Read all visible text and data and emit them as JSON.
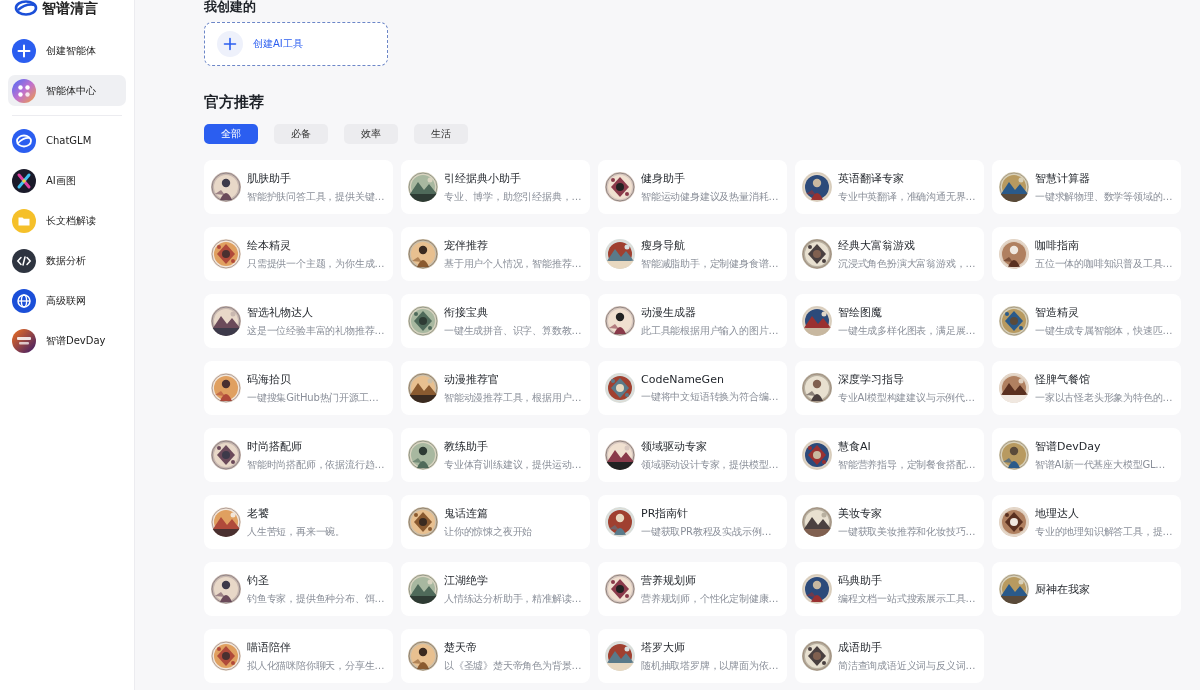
{
  "sidebar": {
    "brand": "智谱清言",
    "actions": [
      {
        "label": "创建智能体",
        "selected": false
      },
      {
        "label": "智能体中心",
        "selected": true
      }
    ],
    "tools": [
      {
        "label": "ChatGLM",
        "selected": false
      },
      {
        "label": "AI画图",
        "selected": false
      },
      {
        "label": "长文档解读",
        "selected": false
      },
      {
        "label": "数据分析",
        "selected": false
      },
      {
        "label": "高级联网",
        "selected": false
      },
      {
        "label": "智谱DevDay",
        "selected": false
      }
    ]
  },
  "my_created": {
    "title": "我创建的",
    "create_button": "创建AI工具"
  },
  "official": {
    "title": "官方推荐",
    "tabs": [
      {
        "label": "全部",
        "selected": true
      },
      {
        "label": "必备",
        "selected": false
      },
      {
        "label": "效率",
        "selected": false
      },
      {
        "label": "生活",
        "selected": false
      }
    ],
    "cards": [
      {
        "title": "肌肤助手",
        "desc": "智能护肤问答工具，提供关键…"
      },
      {
        "title": "引经据典小助手",
        "desc": "专业、博学，助您引经据典，…"
      },
      {
        "title": "健身助手",
        "desc": "智能运动健身建议及热量消耗…"
      },
      {
        "title": "英语翻译专家",
        "desc": "专业中英翻译，准确沟通无界…"
      },
      {
        "title": "智慧计算器",
        "desc": "一键求解物理、数学等领域的…"
      },
      {
        "title": "绘本精灵",
        "desc": "只需提供一个主题，为你生成…"
      },
      {
        "title": "宠伴推荐",
        "desc": "基于用户个人情况，智能推荐…"
      },
      {
        "title": "瘦身导航",
        "desc": "智能减脂助手，定制健身食谱…"
      },
      {
        "title": "经典大富翁游戏",
        "desc": "沉浸式角色扮演大富翁游戏，…"
      },
      {
        "title": "咖啡指南",
        "desc": "五位一体的咖啡知识普及工具…"
      },
      {
        "title": "智选礼物达人",
        "desc": "这是一位经验丰富的礼物推荐…"
      },
      {
        "title": "衔接宝典",
        "desc": "一键生成拼音、识字、算数教…"
      },
      {
        "title": "动漫生成器",
        "desc": "此工具能根据用户输入的图片…"
      },
      {
        "title": "智绘图魔",
        "desc": "一键生成多样化图表，满足展…"
      },
      {
        "title": "智造精灵",
        "desc": "一键生成专属智能体，快速匹…"
      },
      {
        "title": "码海拾贝",
        "desc": "一键搜集GitHub热门开源工…"
      },
      {
        "title": "动漫推荐官",
        "desc": "智能动漫推荐工具，根据用户…"
      },
      {
        "title": "CodeNameGen",
        "desc": "一键将中文短语转换为符合编…"
      },
      {
        "title": "深度学习指导",
        "desc": "专业AI模型构建建议与示例代…"
      },
      {
        "title": "怪脾气餐馆",
        "desc": "一家以古怪老头形象为特色的…"
      },
      {
        "title": "时尚搭配师",
        "desc": "智能时尚搭配师，依据流行趋…"
      },
      {
        "title": "教练助手",
        "desc": "专业体育训练建议，提供运动…"
      },
      {
        "title": "领域驱动专家",
        "desc": "领域驱动设计专家，提供模型…"
      },
      {
        "title": "慧食AI",
        "desc": "智能营养指导，定制餐食搭配…"
      },
      {
        "title": "智谱DevDay",
        "desc": "智谱AI新一代基座大模型GL…"
      },
      {
        "title": "老饕",
        "desc": "人生苦短，再来一碗。"
      },
      {
        "title": "鬼话连篇",
        "desc": "让你的惊悚之夜开始"
      },
      {
        "title": "PR指南针",
        "desc": "一键获取PR教程及实战示例…"
      },
      {
        "title": "美妆专家",
        "desc": "一键获取美妆推荐和化妆技巧…"
      },
      {
        "title": "地理达人",
        "desc": "专业的地理知识解答工具，提…"
      },
      {
        "title": "钓圣",
        "desc": "钓鱼专家，提供鱼种分布、饵…"
      },
      {
        "title": "江湖绝学",
        "desc": "人情练达分析助手，精准解读…"
      },
      {
        "title": "营养规划师",
        "desc": "营养规划师，个性化定制健康…"
      },
      {
        "title": "码典助手",
        "desc": "编程文档一站式搜索展示工具…"
      },
      {
        "title": "厨神在我家"
      },
      {
        "title": "喵语陪伴",
        "desc": "拟人化猫咪陪你聊天，分享生…"
      },
      {
        "title": "楚天帝",
        "desc": "以《圣墟》楚天帝角色为背景…"
      },
      {
        "title": "塔罗大师",
        "desc": "随机抽取塔罗牌，以牌面为依…"
      },
      {
        "title": "成语助手",
        "desc": "简洁查询成语近义词与反义词…"
      }
    ]
  }
}
